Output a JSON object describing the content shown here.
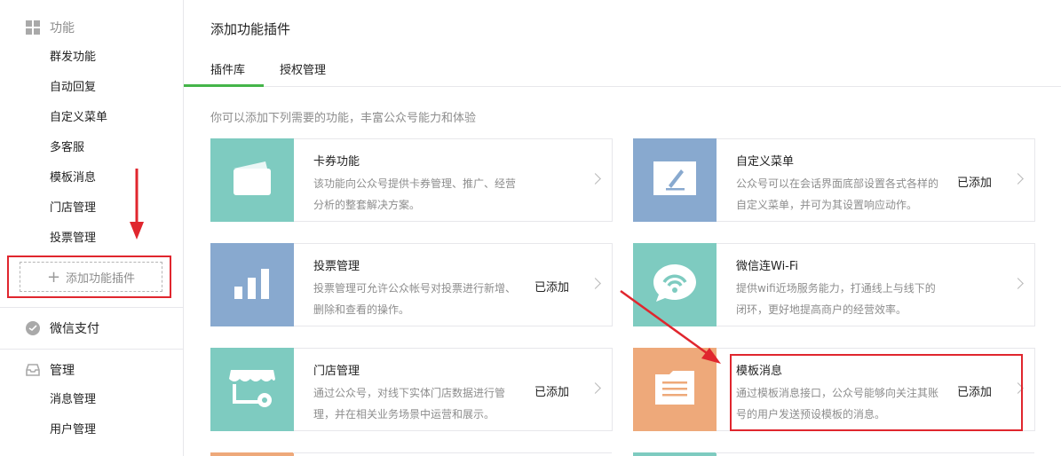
{
  "sidebar": {
    "functions_header": "功能",
    "function_items": [
      "群发功能",
      "自动回复",
      "自定义菜单",
      "多客服",
      "模板消息",
      "门店管理",
      "投票管理"
    ],
    "add_plugin_label": "添加功能插件",
    "wechat_pay": "微信支付",
    "management_header": "管理",
    "management_items": [
      "消息管理",
      "用户管理"
    ]
  },
  "main": {
    "page_title": "添加功能插件",
    "tabs": [
      "插件库",
      "授权管理"
    ],
    "intro": "你可以添加下列需要的功能，丰富公众号能力和体验",
    "cards": [
      {
        "name": "卡券功能",
        "desc": "该功能向公众号提供卡券管理、推广、经营分析的整套解决方案。",
        "added": "",
        "icon": "card-wallet-icon",
        "color": "#7ecbc0"
      },
      {
        "name": "自定义菜单",
        "desc": "公众号可以在会话界面底部设置各式各样的自定义菜单，并可为其设置响应动作。",
        "added": "已添加",
        "icon": "edit-pen-icon",
        "color": "#88a9cf"
      },
      {
        "name": "投票管理",
        "desc": "投票管理可允许公众帐号对投票进行新增、删除和查看的操作。",
        "added": "已添加",
        "icon": "bar-chart-icon",
        "color": "#88a9cf"
      },
      {
        "name": "微信连Wi-Fi",
        "desc": "提供wifi近场服务能力，打通线上与线下的闭环，更好地提高商户的经营效率。",
        "added": "",
        "icon": "wifi-chat-icon",
        "color": "#7ecbc0"
      },
      {
        "name": "门店管理",
        "desc": "通过公众号，对线下实体门店数据进行管理，并在相关业务场景中运营和展示。",
        "added": "已添加",
        "icon": "store-icon",
        "color": "#7ecbc0"
      },
      {
        "name": "模板消息",
        "desc": "通过模板消息接口，公众号能够向关注其账号的用户发送预设模板的消息。",
        "added": "已添加",
        "icon": "document-icon",
        "color": "#eea97a"
      }
    ]
  },
  "colors": {
    "accent_green": "#44b549",
    "annotation_red": "#e0262e"
  }
}
